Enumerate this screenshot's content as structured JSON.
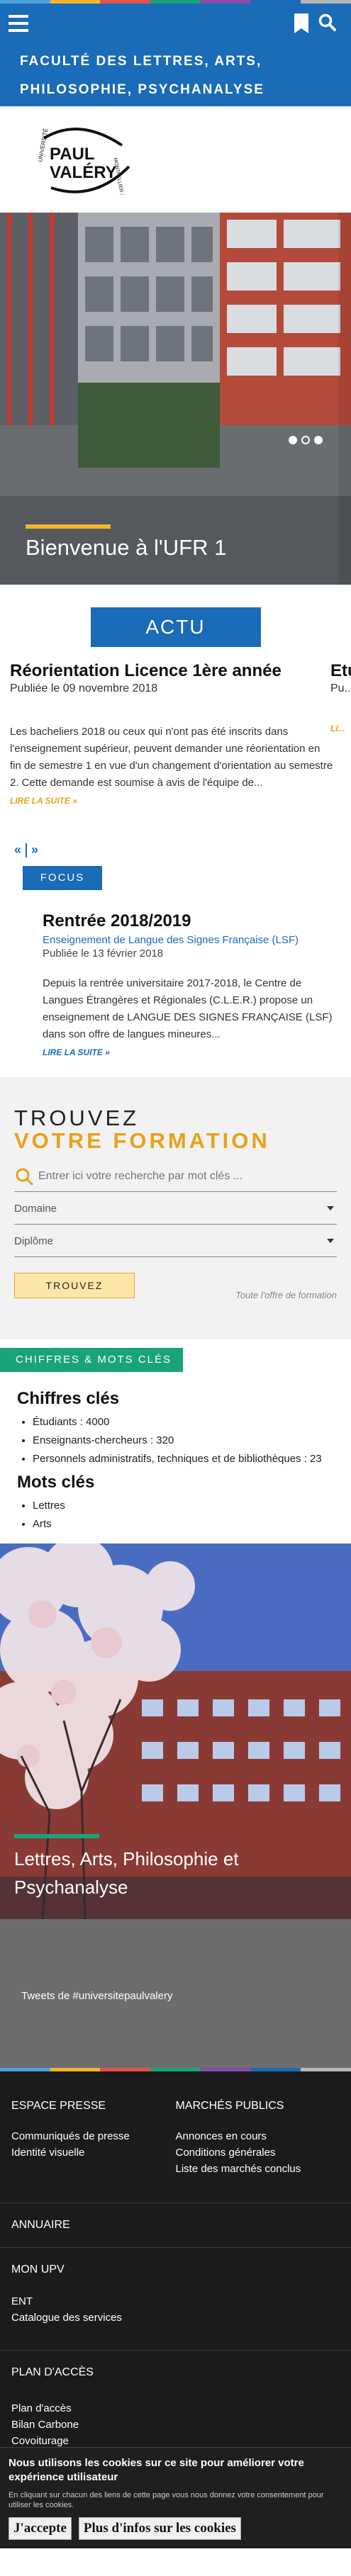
{
  "stripe_colors": [
    "#4aa3df",
    "#f3b52c",
    "#e3534b",
    "#1aa37a",
    "#8a4ca8",
    "#1a6bb8",
    "#b5b7b9"
  ],
  "header": {
    "title": "Faculté des Lettres, Arts, Philosophie, Psychanalyse"
  },
  "logo": {
    "text": [
      "UNIVERSITÉ",
      "PAUL",
      "VALÉRY",
      "MONTPELLIER 3"
    ]
  },
  "hero": {
    "caption": "Bienvenue à l'UFR 1"
  },
  "actu": {
    "label": "ACTU",
    "news": [
      {
        "title": "Réorientation Licence 1ère année",
        "date": "Publiée le 09 novembre 2018",
        "body": "Les bacheliers 2018 ou ceux qui n'ont pas été inscrits  dans l'enseignement supérieur, peuvent demander une réorientation en fin de semestre 1 en vue d'un changement d'orientation au semestre 2. Cette demande est soumise à avis de l'équipe de...",
        "more": "LIRE LA SUITE »"
      },
      {
        "title": "Etudiants en tr...",
        "date": "Pu...",
        "body": "",
        "more": "LI..."
      }
    ],
    "prev": "«",
    "next": "»"
  },
  "focus": {
    "label": "FOCUS",
    "title": "Rentrée 2018/2019",
    "category": "Enseignement de Langue des Signes Française (LSF)",
    "date": "Publiée le 13 février 2018",
    "body": "Depuis la rentrée universitaire 2017-2018, le Centre de Langues Étrangères et Régionales (C.L.E.R.) propose un enseignement de LANGUE DES SIGNES FRANÇAISE (LSF) dans son offre de langues mineures...",
    "more": "LIRE LA SUITE »"
  },
  "formation": {
    "title1": "TROUVEZ",
    "title2": "VOTRE FORMATION",
    "search_placeholder": "Entrer ici votre recherche par mot clés ...",
    "domain_label": "Domaine",
    "diploma_label": "Diplôme",
    "find_label": "TROUVEZ",
    "all_offer": "Toute l'offre de formation"
  },
  "chiffres": {
    "tag": "CHIFFRES & MOTS CLÉS",
    "title": "Chiffres clés",
    "items": [
      "Étudiants : 4000",
      "Enseignants-chercheurs : 320",
      "Personnels administratifs, techniques et de bibliothèques : 23"
    ],
    "keywords_title": "Mots clés",
    "keywords": [
      "Lettres",
      "Arts"
    ]
  },
  "lettres": {
    "caption": "Lettres, Arts, Philosophie et Psychanalyse"
  },
  "tweets": {
    "label": "Tweets de #universitepaulvalery"
  },
  "footer": {
    "press": {
      "head": "ESPACE PRESSE",
      "links": [
        "Communiqués de presse",
        "Identité visuelle"
      ]
    },
    "markets": {
      "head": "MARCHÉS PUBLICS",
      "links": [
        "Annonces en cours",
        "Conditions générales",
        "Liste des marchés conclus"
      ]
    },
    "annuaire": "ANNUAIRE",
    "monupv": {
      "head": "MON UPV",
      "links": [
        "ENT",
        "Catalogue des services"
      ]
    },
    "plan": {
      "head": "PLAN D'ACCÈS",
      "links": [
        "Plan d'accès",
        "Bilan Carbone",
        "Covoiturage"
      ]
    }
  },
  "cookie": {
    "title": "Nous utilisons les cookies sur ce site pour améliorer votre expérience utilisateur",
    "sub": "En cliquant sur chacun des liens de cette page vous nous donnez votre consentement pour utiliser les cookies.",
    "accept": "J'accepte",
    "more": "Plus d'infos sur les cookies"
  }
}
